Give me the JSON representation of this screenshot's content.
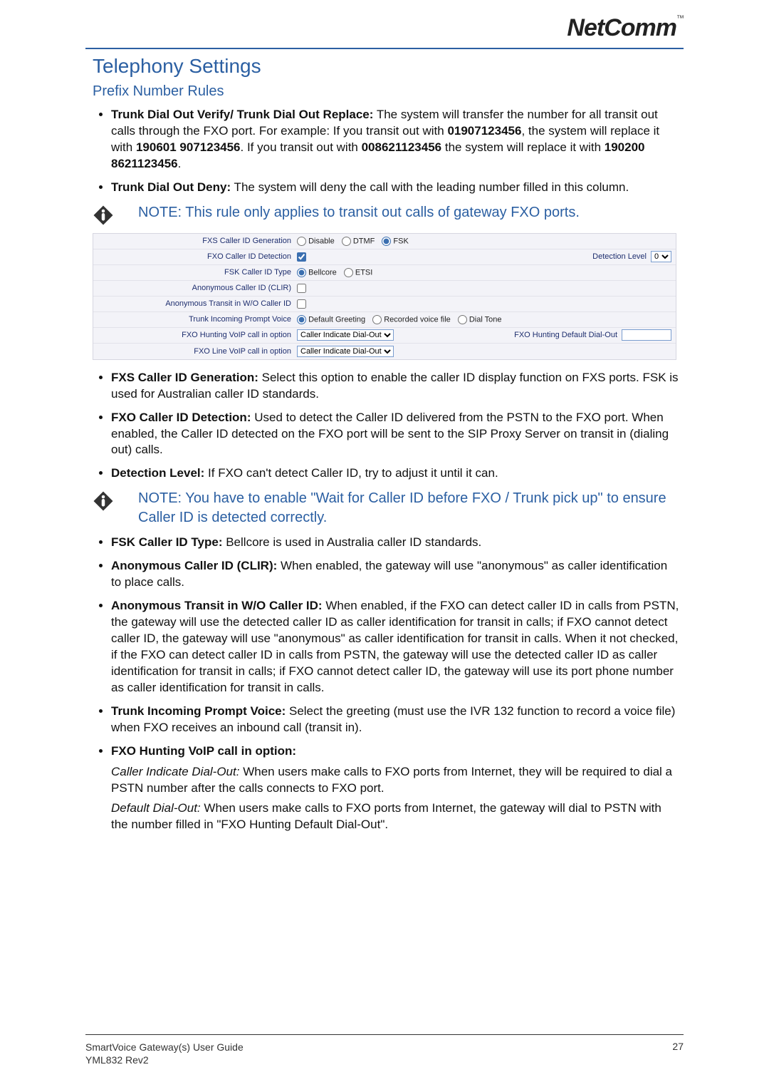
{
  "brand": "NetComm",
  "brand_tm": "™",
  "heading": "Telephony Settings",
  "subsection": "Prefix Number Rules",
  "bullets_top": [
    {
      "bold": "Trunk Dial Out Verify/ Trunk Dial Out Replace:",
      "text": " The system will transfer the number for all transit out calls through the FXO port. For example: If you transit out with ",
      "b2": "01907123456",
      "t2": ", the system will replace it with ",
      "b3": "190601 907123456",
      "t3": ". If you transit out with ",
      "b4": "008621123456",
      "t4": " the system will replace it with ",
      "b5": "190200 8621123456",
      "t5": "."
    },
    {
      "bold": "Trunk Dial Out Deny:",
      "text": " The system will deny the call with the leading number filled in this column."
    }
  ],
  "note1": "NOTE: This rule only applies to transit out calls of gateway FXO ports.",
  "settings": {
    "row1": {
      "label": "FXS Caller ID Generation",
      "opt1": "Disable",
      "opt2": "DTMF",
      "opt3": "FSK"
    },
    "row2": {
      "label": "FXO Caller ID Detection",
      "right_label": "Detection Level",
      "right_value": "0"
    },
    "row3": {
      "label": "FSK Caller ID Type",
      "opt1": "Bellcore",
      "opt2": "ETSI"
    },
    "row4": {
      "label": "Anonymous Caller ID (CLIR)"
    },
    "row5": {
      "label": "Anonymous Transit in W/O Caller ID"
    },
    "row6": {
      "label": "Trunk Incoming Prompt Voice",
      "opt1": "Default Greeting",
      "opt2": "Recorded voice file",
      "opt3": "Dial Tone"
    },
    "row7": {
      "label": "FXO Hunting VoIP call in option",
      "select": "Caller Indicate Dial-Out",
      "right_label": "FXO Hunting Default Dial-Out"
    },
    "row8": {
      "label": "FXO Line VoIP call in option",
      "select": "Caller Indicate Dial-Out"
    }
  },
  "bullets_mid": [
    {
      "bold": "FXS Caller ID Generation:",
      "text": " Select this option to enable the caller ID display function on FXS ports. FSK is used for Australian caller ID standards."
    },
    {
      "bold": "FXO Caller ID Detection:",
      "text": " Used to detect the Caller ID delivered from the PSTN to the FXO port. When enabled, the Caller ID detected on the FXO port will be sent to the SIP Proxy Server on transit in (dialing out) calls."
    },
    {
      "bold": "Detection Level:",
      "text": " If FXO can't detect Caller ID, try to adjust it until it can."
    }
  ],
  "note2": "NOTE: You have to enable \"Wait for Caller ID before FXO / Trunk pick up\" to ensure Caller ID is detected correctly.",
  "bullets_bottom": [
    {
      "bold": "FSK Caller ID Type:",
      "text": " Bellcore is used in Australia caller ID standards."
    },
    {
      "bold": "Anonymous Caller ID (CLIR):",
      "text": " When enabled, the gateway will use \"anonymous\" as caller identification to place calls."
    },
    {
      "bold": "Anonymous Transit in W/O Caller ID:",
      "text": " When enabled, if the FXO can detect caller ID in calls from PSTN, the gateway will use the detected caller ID as caller identification for transit in calls; if FXO cannot detect caller ID, the gateway will use \"anonymous\" as caller identification for transit in calls. When it not checked, if the FXO can detect caller ID in calls from PSTN, the gateway will use the detected caller ID as caller identification for transit in calls; if FXO cannot detect caller ID, the gateway will use its port phone number as caller identification for transit in calls."
    },
    {
      "bold": "Trunk Incoming Prompt Voice:",
      "text": " Select the greeting (must use the IVR 132 function to record a voice file) when FXO receives an inbound call (transit in)."
    },
    {
      "bold": "FXO Hunting VoIP call in option:",
      "text": ""
    }
  ],
  "sublist": {
    "p1_italic": "Caller Indicate Dial-Out:",
    "p1_text": " When users make calls to FXO ports from Internet, they will be required to dial a PSTN number after the calls connects to FXO port.",
    "p2_italic": "Default Dial-Out:",
    "p2_text": " When users make calls to FXO ports from Internet, the gateway will dial to PSTN with the number filled in \"FXO Hunting Default Dial-Out\"."
  },
  "footer": {
    "guide": "SmartVoice Gateway(s) User Guide",
    "rev": "YML832 Rev2",
    "page": "27"
  }
}
